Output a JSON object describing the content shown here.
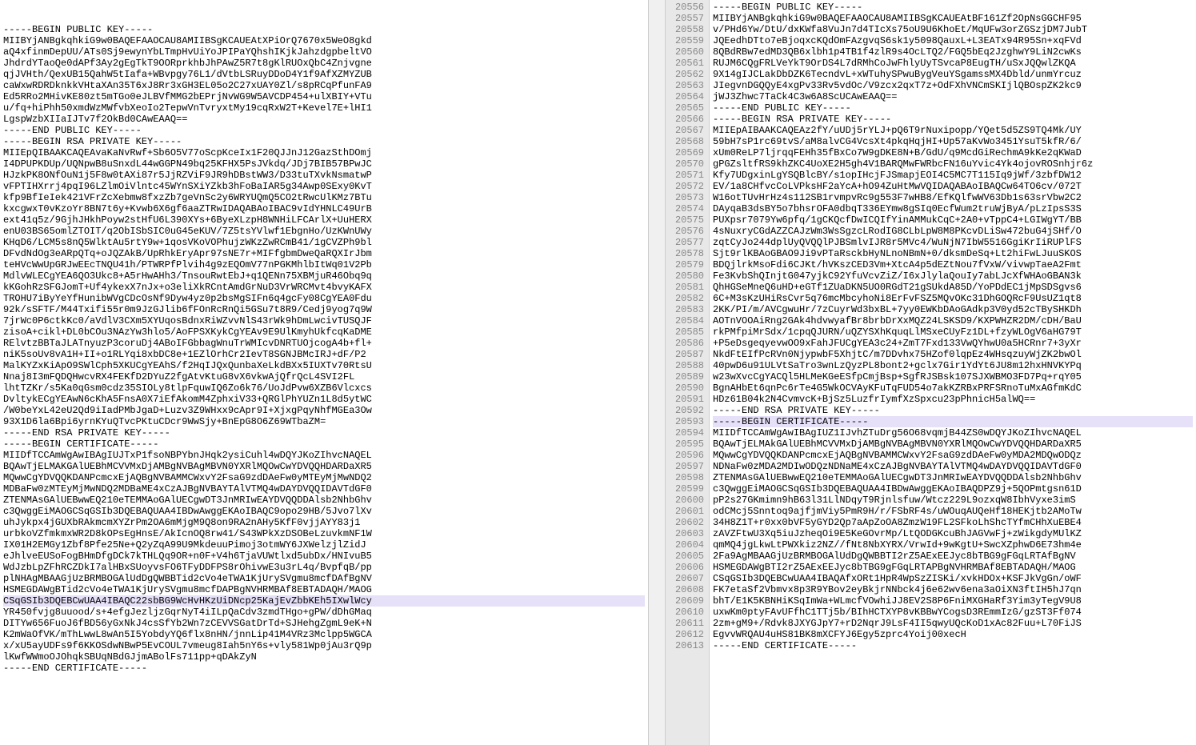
{
  "left": {
    "lines": [
      "-----BEGIN PUBLIC KEY-----",
      "MIIBYjANBgkqhkiG9w0BAQEFAAOCAU8AMIIBSgKCAUEAtXPiOrQ7670x5WeO8gkd",
      "aQ4xfinmDepUU/ATs0Sj9ewynYbLTmpHvUiYoJPIPaYQhshIKjkJahzdgpbeltVO",
      "JhdrdYTaoQe0dAPf3Ay2gEgTkT9OORprkhbJhPAwZ5R7t8gKlRUOxQbC4Znjvgne",
      "qjJVHth/QexUB15QahW5tIafa+WBvpgy76L1/dVtbLSRuyDDoD4Y1f9AfXZMYZUB",
      "caWxwRDRDknkkVHtaXAn35T6xJ8Rr3xGH3EL05o2C27xUAY0Zl/s8pRCqPfunFA9",
      "Ed5RRo2MHivKE80zt5mTGo0eJLBVfMMG2bEPrjNvWG9W5AVCDP454+ulXBIY+VTu",
      "u/fq+hiPhh50xmdWzMWfvbXeoIo2TepwVnTvryxtMy19cqRxW2T+Kevel7E+lHI1",
      "LgspWzbXIIaIJTv7f2OkBd0CAwEAAQ==",
      "-----END PUBLIC KEY-----",
      "-----BEGIN RSA PRIVATE KEY-----",
      "MIIEpQIBAAKCAQEAvaKaNvRwf+Sb6O5V77oScpKceIx1F20QJJnJ12GazSthDOmj",
      "I4DPUPKDUp/UQNpwB8uSnxdL44wGGPN49bq25KFHX5PsJVkdq/JDj7BIB57BPwJC",
      "HJzkPK8ONfOuN1j5F8w0tAXi87r5JjRZViF9JR9hDBstWW3/D33tuTXvkNsmatwP",
      "vFPTIHXrrj4pqI96LZlmOiVlntc45WYnSXiYZkb3hFoBaIAR5g34Awp0SExy0KvT",
      "kfp9BfIeIek421VFrZcXebmw8fxzZb7geVnSc2y6WRYUQmQ5CO2tRwcUlKMz7BTu",
      "kxcgwxT0vKzoYr8BN7t6y+Kvwb6X6gf6aaZTRwIDAQABAoIBAC9vIdYHNLC49UrB",
      "ext41q5z/9GjhJHkhPoyw2stHfU6L390XYs+6ByeXLzpH8WNHiLFCArlX+UuHERX",
      "enU03BS65omlZTOIT/q2ObISbSIC0uG45eKUV/7Z5tsYVlwf1EbgnHo/UzKWnUWy",
      "KHqD6/LCM5s8nQ5WlktAu5rtY9w+1qosVKoVOPhujzWKzZwRCmB41/1gCVZPh9bl",
      "DFvdNdOg3eARpQTq+oJQZAkB/UpRhkEryApr97sNE7r+MIFfgbmDweQaRQXIrJbm",
      "teHVcWwUpGRJwEEcTNQU41h/PTWRPfPlvih4g9zEQOmV77nPGKMhlbItWq01V2Pb",
      "MdlvWLECgYEA6QO3Ukc8+A5rHwAHh3/TnsouRwtEbJ+q1QENn75XBMjuR46Obq9q",
      "kKGohRzSFGJomT+Uf4ykexX7nJx+o3eliXkRCntAmdGrNuD3VrWRCMvt4bvyKAFX",
      "TROHU7iByYeYfHunibWVgCDcOsNf9Dyw4yz0p2bsMgSIFn6q4gcFy08CgYEA0Fdu",
      "92k/sSFTF/M44Txifi55r0m9JzGJlib6fFOnRcRnQi5GSu7t8R9/Cedj9yog7q9W",
      "7jrWc0P6ctkKc0/aVdlV3CXm5XYUqosBdnxRiWZvvNlS43rWk9hDmLwcivTUSQJF",
      "zisoA+cikl+DL0bCOu3NAzYw3hlo5/AoFPSXKykCgYEAv9E9UlKmyhUkfcqKaDME",
      "RElvtzBBTaJLATnyuzP3coruDj4ABoIFGbbagWnuTrWMIcvDNRTUOjcogA4b+fl+",
      "niK5soUv8vA1H+II+o1RLYqi8xbDC8e+1EZlOrhCr2IevT8SGNJBMcIRJ+dF/P2",
      "MalKYZxKiApO9SWlCph5XKUCgYEAhS/f2HqIJQxQunbaXeLkdBXx5IUXTv70RtsU",
      "Nnaj8I3mFQDQHwcvRX4FEKfD2DYuZ2fgAtvKtuG8vX6vkwAjQfrQcL4SVI2FL",
      "lhtTZKr/s5Ka0qGsm0cdz35SIOLy8tlpFquwIQ6Zo6k76/UoJdPvw6XZB6Vlcxcs",
      "DvltykECgYEAwN6cKhA5FnsA0X7iEfAkomM4ZphxiV33+QRGlPhYUZn1L8d5ytWC",
      "/W0beYxL42eU2Qd9iIadPMbJgaD+Luzv3Z9WHxx9cApr9I+XjxgPqyNhfMGEa3Ow",
      "93X1D6la6Bpi6yrnKYuQTvcPKtuCDcr9WwSjy+BnEpG8O6Z69WTbaZM=",
      "-----END RSA PRIVATE KEY-----",
      "-----BEGIN CERTIFICATE-----",
      "MIIDfTCCAmWgAwIBAgIUJTxP1fsoNBPYbnJHqk2ysiCuhl4wDQYJKoZIhvcNAQEL",
      "BQAwTjELMAKGAlUEBhMCVVMxDjAMBgNVBAgMBVN0YXRlMQOwCwYDVQQHDARDaXR5",
      "MQwwCgYDVQQKDANPcmcxEjAQBgNVBAMMCWxvY2FsaG9zdDAeFw0yMTEyMjMwNDQ2",
      "MDBaFw0zMTEyMjMwNDQ2MDBaME4xCzAJBgNVBAYTAlVTMQ4wDAYDVQQIDAVTdGF0",
      "ZTENMAsGAlUEBwwEQ210eTEMMAoGAlUECgwDT3JnMRIwEAYDVQQDDAlsb2NhbGhv",
      "c3QwggEiMAOGCSqGSIb3DQEBAQUAA4IBDwAwggEKAoIBAQC9opo29HB/5Jvo7lXv",
      "uhJykpx4jGUXbRAkmcmXYZrPm2OA6mMjgM9Q8on9RA2nAHy5KfF0vjjAYY83j1",
      "urbkoVZfmkmxWR2D8kOPsEgHnsE/AkIcnOQ8rw41/S43WPkXzDSOBeLzuvkmNF1W",
      "IX01H2EMGy1Zbf8Pfe25Ne+Q2yZqA99U9MkdeuuPimoj3otmWY6JXWelzjlZidJ",
      "eJhlveEUSoFogBHmDfgDCk7kTHLQq9OR+n0F+V4h6TjaVUWtlxd5ubDx/HNIvuB5",
      "WdJzbLpZFhRCZDkI7alHBxSUoyvsFO6TFyDDFPS8rOhivwE3u3rL4q/BvpfqB/pp",
      "plNHAgMBAAGjUzBRMBOGAlUdDgQWBBTid2cVo4eTWA1KjUrySVgmu8mcfDAfBgNV",
      "HSMEGDAWgBTid2cVo4eTWA1KjUrySVgmu8mcfDAPBgNVHRMBAf8EBTADAQH/MAOG",
      "CSqGSIb3DQEBCwUAA4IBAQC22sbBG9WcHvHKzUiDNcp25KajEvZbbKEh5IXwlWcy",
      "YR450fvjg8uuood/s+4efgJezljzGqrNyT4iILpQaCdv3zmdTHgo+gPW/dDhGMaq",
      "DITYw656FuoJ6fBD56yGxNkJ4csSfYb2Wn7zCEVVSGatDrTd+SJHehgZgmL9eK+N",
      "K2mWaOfVK/mThLwwL8wAn5I5YobdyYQ6flx8nHN/jnnLip41M4VRz3Mclpp5WGCA",
      "x/xU5ayUDFs9f6KKOSdwNBwP5EvCOUL7vmeug8Iah5nY6s+vly581Wp0jAu3rQ9p",
      "lKwfWWmoOJOhqkSBUqNBdGJjmABolFs711pp+qDAkZyN",
      "-----END CERTIFICATE-----"
    ],
    "highlights": [
      51
    ]
  },
  "right": {
    "startLine": 20556,
    "lines": [
      "-----BEGIN PUBLIC KEY-----",
      "MIIBYjANBgkqhkiG9w0BAQEFAAOCAU8AMIIBSgKCAUEAtBF161Zf2OpNsGGCHF95",
      "v/PHd6Yw/DtU/dxKWfa8VuJn7d4TIcXs75oU9U6KhoEt/MqUFw3orZGSzjDM7JubT",
      "JQEedhDTto7eBjoqxcKQdOmFAzgvqS6sk1y5098QauxL+L3EATx94R95Sn+xqFVd",
      "8QBdRBw7edMD3QB6xlbh1p4TB1f4zlR9s4OcLTQ2/FGQ5bEq2JzghwY9LiN2cwKs",
      "RUJM6CQgFRLVeYkT9OrDS4L7dRMhCoJwFhlyUyTSvcaP8EugTH/uSxJQQwlZKQA",
      "9X14gIJCLakDbDZK6TecndvL+xWTuhySPwuBygVeuYSgamssMX4Dbld/unmYrcuz",
      "JIegvnDGQQyE4xgPv33Rv5vdOc/V9zcx2qxT7z+OdFXhVNCmSKIjlQBOspZK2kc9",
      "jWJ3Zhwc7TaCk4C3w6A8ScUCAwEAAQ==",
      "-----END PUBLIC KEY-----",
      "-----BEGIN RSA PRIVATE KEY-----",
      "MIIEpAIBAAKCAQEAz2fY/uUDj5rYLJ+pQ6T9rNuxipopp/YQet5d5ZS9TQ4Mk/UY",
      "59bH7sP1rc69tvS/aM8alvCG4VcsXt4pkqHqjHI+Up57aKvWo3451YsuT5kfR/6/",
      "xUm0ReLP7ljrqqFEHh35fBxCo7W9gDKE8N+B/GdU/q9McdGiRechmA9kKe2qKWaD",
      "gPGZsltfRS9khZKC4UoXE2H5gh4V1BARQMwFWRbcFN16uYvic4Yk4ojovROSnhjr6z",
      "Kfy7UDgxinLgYSQBlcBY/s1opIHcjFJSmapjEOI4C5MC7T115Iq9jWf/3zbfDW12",
      "EV/1a8CHfvcCoLVPksHF2aYcA+hO94ZuHtMwVQIDAQABAoIBAQCw64TO6cv/072T",
      "W16otTUvHrHz4s112SB1rvmpvRc9g553F7wHB8/EfKQlfwWV63Db1s63srVbw2C2",
      "DAyqaB3dsBY5o7bhsrOFA0dbqT336EYmw8gSIq0EcfWum2truWjByA/pLzIpsS3S",
      "PUXpsr7079Yw6pfq/1gCKQcfDwICQIfYinAMMukCqC+2A0+vTppC4+LGIWgYT/BB",
      "4sNuxryCGdAZZCAJzWm3WsSgzcLRodIG8CLbLpW8M8PKcvDLiSw472buG4jSHf/O",
      "zqtCyJo244dplUyQVQQlPJBSmlvIJR8r5MVc4/WuNjN7IbW5516GgiKrIiRUPlFS",
      "Sjt9rlKBAoGBAO9Ji9vPTaRsckbHyNLnoNBmN+0/dksmDeSq+Lt2hiFwLJuuSKOS",
      "BDQjlrkMsoFdi6CJKt/hVKszCED3Vm+XtcA4p5dEZtNou7fVxW/vivwpTaeA2Fmt",
      "Fe3KvbShQInjtG047yjkC92YfuVcvZiZ/I6xJlylaQouIy7abLJcXfWHAoGBAN3k",
      "QhHGSeMneQ6uHD+eGTf1ZUaDKN5UO0RGdT21gSUkdA85D/YoPDdEC1jMpSDSgvs6",
      "6C+M3sKzUHiRsCvr5q76mcMbcyhoNi8ErFvFSZ5MQvOKc31DhGOQRcF9UsUZ1qt8",
      "2KK/PI/m/AVCgwuHr/7zCuyrWd3bxBL+7yy0EWKbDAoGAdkp3V0yd52cTBySHKDh",
      "AOTnVOOAiRng2GAk4hdvwyafBr8brbDrXxMQZ24LSKSD9/KXPWHZR2DM/cDH/BaU",
      "rkPMfpiMrSdx/1cpqQJURN/uQZYSXhKquqLlMSxeCUyFz1DL+fzyWLOgV6aHG79T",
      "+P5eDsgeqyevwOO9xFahJFUCgYEA3c24+ZmT7Fxd133VwQYhwU0a5HCRnr7+3yXr",
      "NkdFtEIfPcRVn0NjypwbF5XhjtC/m7DDvhx75HZof0lqpEz4WHsqzuyWjZK2bwOl",
      "40pwD6u91ULVtSaTro3wnLzQyzPL8bont2+gclx7Gir1YdYt6JU8m12hxHNVKYPq",
      "w23wXvcCgYACQl5HLMeKGeESfpCmjBsp+SgfRJSBsk107SJXWBMO3FD7Pq+rqY05",
      "BgnAHbEt6qnPc6rTe4G5WkOCVAyKFuTqFUD54o7akKZRBxPRFSRnoTuMxAGfmKdC",
      "HDz61B04k2N4CvmvcK+BjSz5LuzfrIymfXzSpxcu23pPhnicH5alWQ==",
      "-----END RSA PRIVATE KEY-----",
      "-----BEGIN CERTIFICATE-----",
      "MIIDfTCCAmWgAwIBAgIUZ1IJvhZTuDrg56O68vqmjB44ZS0wDQYJKoZIhvcNAQEL",
      "BQAwTjELMAkGAlUEBhMCVVMxDjAMBgNVBAgMBVN0YXRlMQOwCwYDVQQHDARDaXR5",
      "MQwwCgYDVQQKDANPcmcxEjAQBgNVBAMMCWxvY2FsaG9zdDAeFw0yMDA2MDQwODQz",
      "NDNaFw0zMDA2MDIwODQzNDNaME4xCzAJBgNVBAYTAlVTMQ4wDAYDVQQIDAVTdGF0",
      "ZTENMAsGAlUEBwwEQ210eTEMMAoGAlUECgwDT3JnMRIwEAYDVQQDDAlsb2NhbGhv",
      "c3QwggEiMAOGCSqGSIb3DQEBAQUAA4IBDwAwggEKAoIBAQDPZ9j+5QOPmtgsn61D",
      "pP2s27GKmimn9hB63l31LlNDqyT9Rjnlsfuw/Wtcz229L9ozxqW8IbhVyxe3imS",
      "odCMcj5Snntoq9ajfjmViy5PmR9H/r/FSbRF4s/uWOuqAUQeHf18HEKjtb2AMoTw",
      "34H8Z1T+r0xx0bVF5yGYD2Qp7aApZoOA8ZmzW19FL2SFkoLhShcTYfmCHhXuEBE4",
      "zAVZFtwU3Xq5iuJzheqOi9E5KeGOvrMp/LtQODGKcuBhJAGVwFj+zWikgdyMUlKZ",
      "qmMQ4jgLkwLtPWXkiz2NZ//fNt8NbXYRX/VrwId+9wKgtU+SwcXZphwD6E73hm4e",
      "2Fa9AgMBAAGjUzBRMBOGAlUdDgQWBBTI2rZ5AExEEJyc8bTBG9gFGqLRTAfBgNV",
      "HSMEGDAWgBTI2rZ5AExEEJyc8bTBG9gFGqLRTAPBgNVHRMBAf8EBTADAQH/MAOG",
      "CSqGSIb3DQEBCwUAA4IBAQAfxORt1HpR4WpSzZISKi/xvkHDOx+KSFJkVgGn/oWF",
      "FK7etaSf2Vbmvx8p3R9YBov2eyBkjrNNbck4j6e62wv6ena3aOiXN3ftIH5hJ7qn",
      "bhT/E1K5KBNHiKSqImWa+WLmcfVOwhiJJ8EV2S8P6FniMXGHaRf3Yim3yTegV9U8",
      "uxwKm0ptyFAvUFfhC1TTj5b/BIhHCTXYP8vKBBwYCogsD3REmmIzG/gzST3Ff074",
      "2zm+gM9+/Rdvk8JXYGJpY7+rD2NqrJ9LsF4II5qwyUQcKoD1xAc82Fuu+L70FiJS",
      "EgvvWRQAU4uHS81BK8mXCFYJ6Egy5zprc4Yoij00xecH",
      "-----END CERTIFICATE-----"
    ],
    "highlights": [
      20593
    ]
  }
}
